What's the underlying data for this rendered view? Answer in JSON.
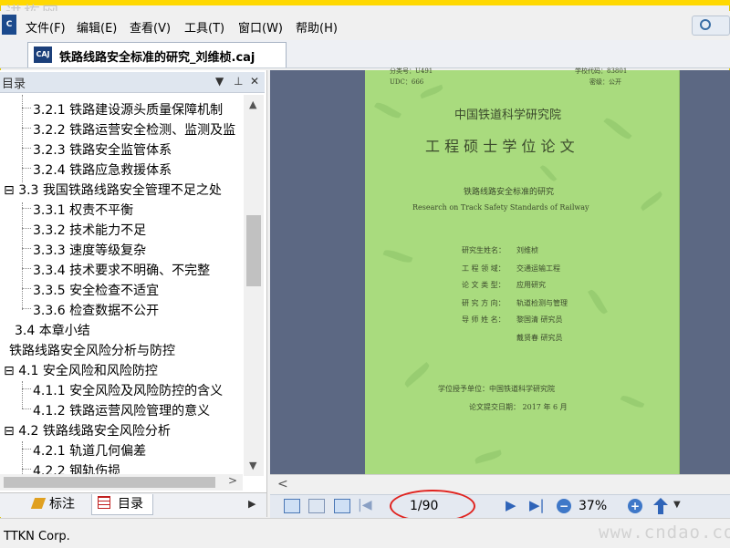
{
  "watermark_top": "进栋网",
  "menu": [
    "文件(F)",
    "编辑(E)",
    "查看(V)",
    "工具(T)",
    "窗口(W)",
    "帮助(H)"
  ],
  "tab": {
    "icon": "CAJ",
    "title": "铁路线路安全标准的研究_刘维桢.caj"
  },
  "panel": {
    "title": "目录",
    "toc": [
      "3.2.1 铁路建设源头质量保障机制",
      "3.2.2 铁路运营安全检测、监测及监",
      "3.2.3 铁路安全监管体系",
      "3.2.4 铁路应急救援体系",
      "3.3 我国铁路线路安全管理不足之处",
      "3.3.1 权责不平衡",
      "3.3.2 技术能力不足",
      "3.3.3 速度等级复杂",
      "3.3.4 技术要求不明确、不完整",
      "3.3.5 安全检查不适宜",
      "3.3.6 检查数据不公开",
      "3.4 本章小结",
      "铁路线路安全风险分析与防控",
      "4.1 安全风险和风险防控",
      "4.1.1 安全风险及风险防控的含义",
      "4.1.2 铁路运营风险管理的意义",
      "4.2 铁路线路安全风险分析",
      "4.2.1 轨道几何偏差",
      "4.2.2 钢轨伤损"
    ],
    "tab_notes": "标注",
    "tab_toc": "目录"
  },
  "page": {
    "top_left_1": "分类号：U491",
    "top_right_1": "学校代码：83801",
    "top_left_2": "UDC：666",
    "top_right_2": "密级：公开",
    "institute": "中国铁道科学研究院",
    "degree": "工 程 硕 士 学 位 论 文",
    "title_cn": "铁路线路安全标准的研究",
    "title_en": "Research on Track Safety Standards of Railway",
    "fields": [
      {
        "k": "研究生姓名：",
        "v": "刘维桢"
      },
      {
        "k": "工 程 领 域：",
        "v": "交通运输工程"
      },
      {
        "k": "论 文 类 型：",
        "v": "应用研究"
      },
      {
        "k": "研 究 方 向：",
        "v": "轨道检测与管理"
      },
      {
        "k": "导 师 姓 名：",
        "v": "黎国清    研究员"
      },
      {
        "k": "",
        "v": "戴贤春    研究员"
      }
    ],
    "grant_unit": "学位授予单位：中国铁道科学研究院",
    "submit_date": "论文提交日期：  2017 年  6 月"
  },
  "nav": {
    "page_indicator": "1/90",
    "zoom": "37%"
  },
  "status": "TTKN Corp.",
  "watermark_br": "www.cndao.com",
  "colors": {
    "page_bg": "#a9db7e",
    "view_bg": "#5c6883",
    "highlight_ring": "#e0231f"
  }
}
